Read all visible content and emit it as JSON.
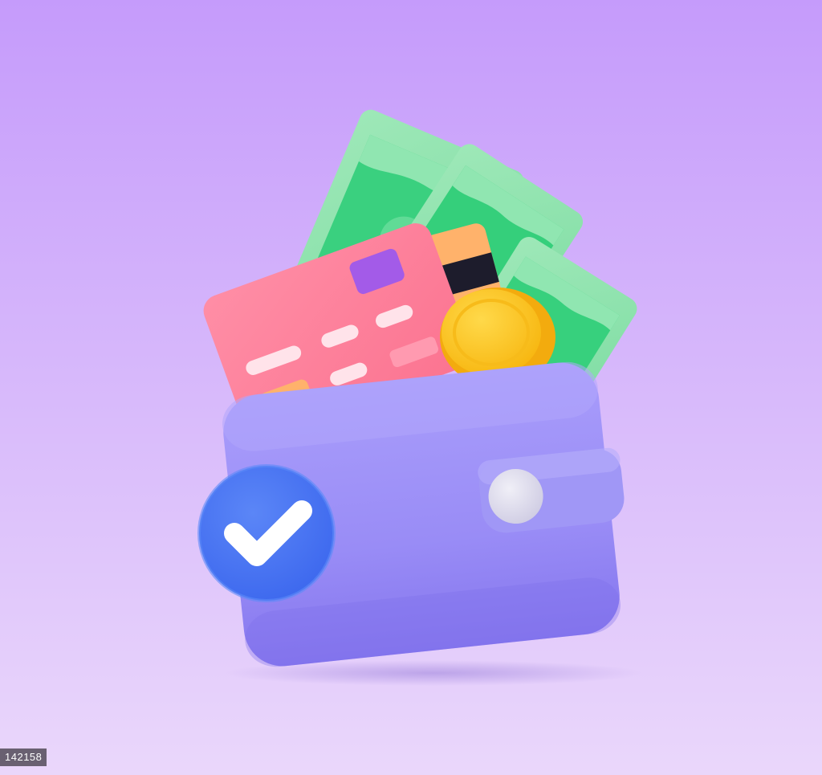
{
  "image": {
    "subject": "3d-wallet-with-cash-card-coin-and-checkmark",
    "icons": [
      "wallet-icon",
      "banknote-icon",
      "credit-card-icon",
      "coin-icon",
      "checkmark-icon",
      "clasp-icon"
    ]
  },
  "colors": {
    "background_top": "#c59bfb",
    "background_bottom": "#ead7fb",
    "wallet": "#9a8cf7",
    "wallet_shade": "#8577ef",
    "clasp": "#9f95f4",
    "clasp_button": "#e3e1ef",
    "banknote": "#3ad07f",
    "banknote_light": "#90e6b1",
    "credit_card": "#fe7f9a",
    "card_chip": "#a35be8",
    "card_tag": "#ffb26b",
    "coin": "#ffc61a",
    "coin_rim": "#f3ab0e",
    "check_badge": "#4774f2",
    "check_mark": "#ffffff"
  },
  "watermark": {
    "text": "142158"
  }
}
